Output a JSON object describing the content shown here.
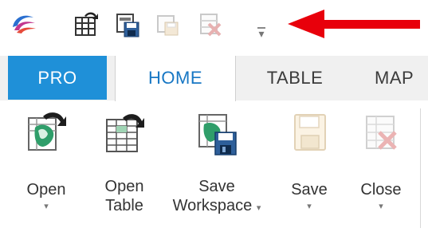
{
  "quick_access": {
    "icons": [
      "app-logo-icon",
      "open-table-icon",
      "save-workspace-icon",
      "save-disabled-icon",
      "close-disabled-icon"
    ],
    "customize_glyph": "▾"
  },
  "tabs": [
    {
      "label": "PRO",
      "state": "backstage"
    },
    {
      "label": "HOME",
      "state": "selected"
    },
    {
      "label": "TABLE",
      "state": "normal"
    },
    {
      "label": "MAP",
      "state": "normal"
    }
  ],
  "ribbon": {
    "open_label": "Open",
    "open_table_line1": "Open",
    "open_table_line2": "Table",
    "save_workspace_line1": "Save",
    "save_workspace_line2": "Workspace",
    "save_label": "Save",
    "close_label": "Close",
    "dropdown_glyph": "▾"
  },
  "colors": {
    "pro_tab": "#1f90d8",
    "home_text": "#1777c4",
    "annotation_arrow": "#e8000b"
  }
}
